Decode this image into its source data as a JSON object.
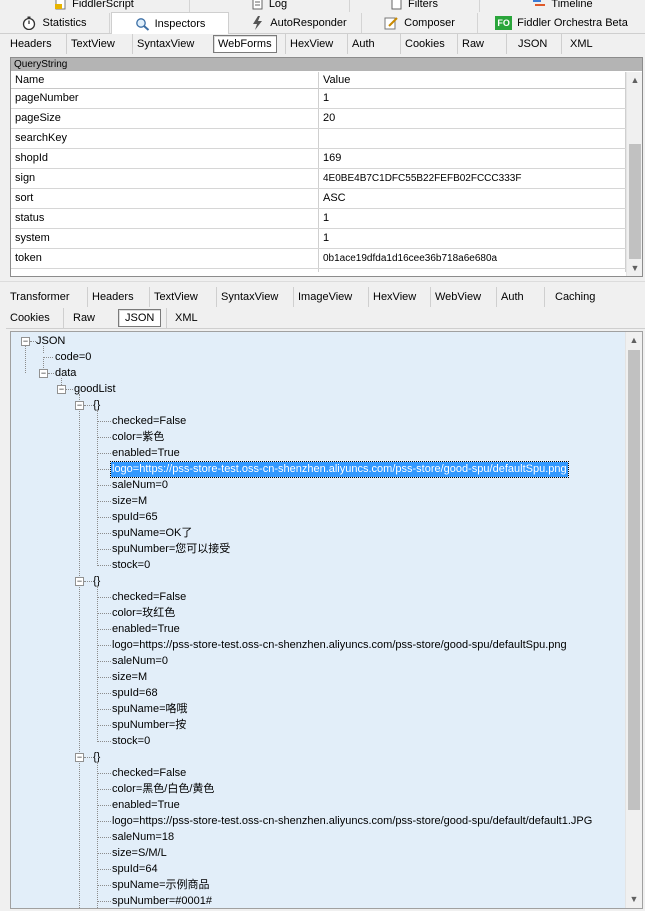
{
  "top_tabs_row1": [
    {
      "label": "FiddlerScript",
      "icon": "script-icon"
    },
    {
      "label": "Log",
      "icon": "log-icon"
    },
    {
      "label": "Filters",
      "icon": "filter-icon"
    },
    {
      "label": "Timeline",
      "icon": "timeline-icon"
    }
  ],
  "top_tabs_row2": [
    {
      "label": "Statistics",
      "icon": "stopwatch-icon"
    },
    {
      "label": "Inspectors",
      "icon": "inspector-icon",
      "active": true
    },
    {
      "label": "AutoResponder",
      "icon": "lightning-icon"
    },
    {
      "label": "Composer",
      "icon": "composer-icon"
    },
    {
      "label": "Fiddler Orchestra Beta",
      "icon": "fo-icon",
      "icon_text": "FO"
    }
  ],
  "request_tabs": [
    "Headers",
    "TextView",
    "SyntaxView",
    "WebForms",
    "HexView",
    "Auth",
    "Cookies",
    "Raw",
    "JSON",
    "XML"
  ],
  "request_active_tab": "WebForms",
  "querystring": {
    "title": "QueryString",
    "columns": [
      "Name",
      "Value"
    ],
    "rows": [
      {
        "name": "pageNumber",
        "value": "1"
      },
      {
        "name": "pageSize",
        "value": "20"
      },
      {
        "name": "searchKey",
        "value": ""
      },
      {
        "name": "shopId",
        "value": "169"
      },
      {
        "name": "sign",
        "value": "4E0BE4B7C1DFC55B22FEFB02FCCC333F"
      },
      {
        "name": "sort",
        "value": "ASC"
      },
      {
        "name": "status",
        "value": "1"
      },
      {
        "name": "system",
        "value": "1"
      },
      {
        "name": "token",
        "value": "0b1ace19dfda1d16cee36b718a6e680a"
      }
    ]
  },
  "response_tabs_row1": [
    "Transformer",
    "Headers",
    "TextView",
    "SyntaxView",
    "ImageView",
    "HexView",
    "WebView",
    "Auth",
    "Caching"
  ],
  "response_tabs_row2": [
    "Cookies",
    "Raw",
    "JSON",
    "XML"
  ],
  "response_active_tab": "JSON",
  "tree": {
    "root": "JSON",
    "code": "code=0",
    "data": "data",
    "goodList": "goodList",
    "items": [
      {
        "label": "{}",
        "fields": [
          "checked=False",
          "color=紫色",
          "enabled=True",
          "logo=https://pss-store-test.oss-cn-shenzhen.aliyuncs.com/pss-store/good-spu/defaultSpu.png",
          "saleNum=0",
          "size=M",
          "spuId=65",
          "spuName=OK了",
          "spuNumber=您可以接受",
          "stock=0"
        ],
        "selected_index": 3
      },
      {
        "label": "{}",
        "fields": [
          "checked=False",
          "color=玫红色",
          "enabled=True",
          "logo=https://pss-store-test.oss-cn-shenzhen.aliyuncs.com/pss-store/good-spu/defaultSpu.png",
          "saleNum=0",
          "size=M",
          "spuId=68",
          "spuName=咯哦",
          "spuNumber=按",
          "stock=0"
        ]
      },
      {
        "label": "{}",
        "fields": [
          "checked=False",
          "color=黑色/白色/黄色",
          "enabled=True",
          "logo=https://pss-store-test.oss-cn-shenzhen.aliyuncs.com/pss-store/good-spu/default/default1.JPG",
          "saleNum=18",
          "size=S/M/L",
          "spuId=64",
          "spuName=示例商品",
          "spuNumber=#0001#"
        ]
      }
    ]
  },
  "colors": {
    "tree_bg": "#e2eef9",
    "selection": "#3399ff",
    "qs_header": "#b4b4b4"
  }
}
